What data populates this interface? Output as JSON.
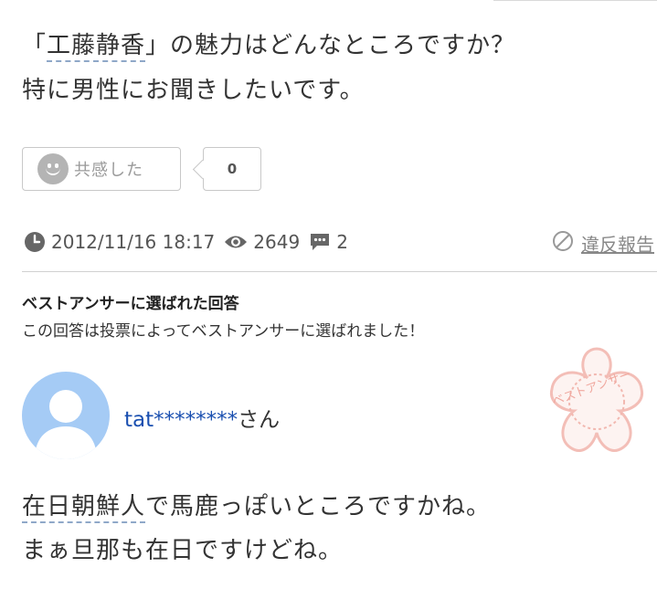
{
  "question": {
    "line1_before": "「",
    "keyword": "工藤静香",
    "line1_after": "」の魅力はどんなところですか？",
    "line2": "特に男性にお聞きしたいです。"
  },
  "empathy": {
    "button_label": "共感した",
    "count": "0"
  },
  "meta": {
    "date": "2012/11/16 18:17",
    "views": "2649",
    "answers": "2",
    "report_label": "違反報告"
  },
  "best_answer": {
    "heading": "ベストアンサーに選ばれた回答",
    "subtitle": "この回答は投票によってベストアンサーに選ばれました！",
    "stamp_text": "ベストアンサー",
    "user_name": "tat********",
    "honorific": "さん",
    "answer_keyword": "在日朝鮮人",
    "answer_line1_after": "で馬鹿っぽいところですかね。",
    "answer_line2": "まぁ旦那も在日ですけどね。"
  },
  "colors": {
    "link": "#1a4fb0",
    "avatar_bg": "#a5cbf5",
    "stamp": "#f2b8b0",
    "keyword_underline": "#8fa8c8"
  },
  "icons": [
    "smiley-icon",
    "clock-icon",
    "eye-icon",
    "comment-icon",
    "prohibited-icon",
    "default-avatar-icon",
    "best-answer-stamp"
  ]
}
